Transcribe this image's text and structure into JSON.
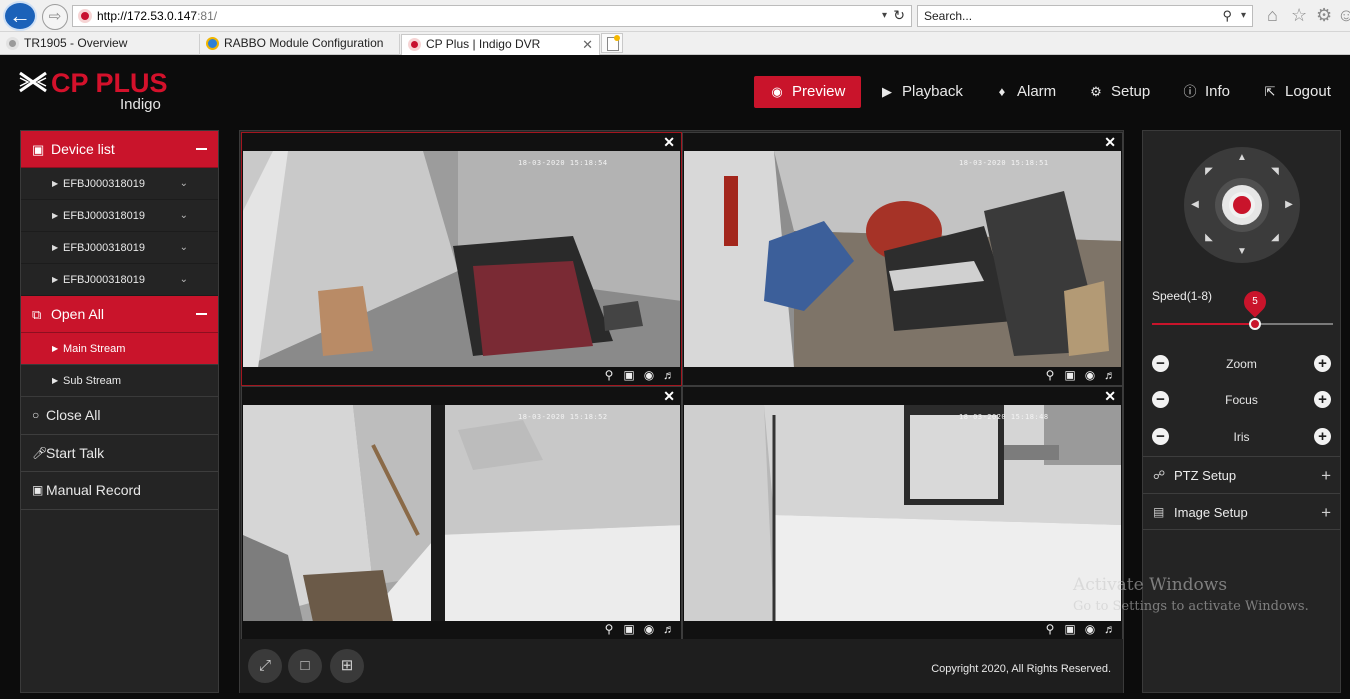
{
  "browser": {
    "url_host": "http://172.53.0.147",
    "url_port": ":81/",
    "search_placeholder": "Search...",
    "tabs": [
      {
        "label": "TR1905 - Overview",
        "active": false
      },
      {
        "label": "RABBO Module Configuration",
        "active": false
      },
      {
        "label": "CP Plus | Indigo DVR",
        "active": true
      }
    ]
  },
  "app": {
    "brand": "CP PLUS",
    "brand_sub": "Indigo",
    "brand_color": "#d4112b",
    "accent": "#c9142b",
    "nav": [
      {
        "label": "Preview",
        "icon": "eye-icon",
        "active": true
      },
      {
        "label": "Playback",
        "icon": "play-icon",
        "active": false
      },
      {
        "label": "Alarm",
        "icon": "bell-icon",
        "active": false
      },
      {
        "label": "Setup",
        "icon": "gear-icon",
        "active": false
      },
      {
        "label": "Info",
        "icon": "info-icon",
        "active": false
      },
      {
        "label": "Logout",
        "icon": "logout-icon",
        "active": false
      }
    ]
  },
  "left_panel": {
    "device_list_label": "Device list",
    "devices": [
      "EFBJ000318019",
      "EFBJ000318019",
      "EFBJ000318019",
      "EFBJ000318019"
    ],
    "open_all_label": "Open All",
    "streams": [
      {
        "label": "Main Stream",
        "selected": true
      },
      {
        "label": "Sub Stream",
        "selected": false
      }
    ],
    "actions": [
      {
        "label": "Close All",
        "icon": "circle-icon"
      },
      {
        "label": "Start Talk",
        "icon": "microphone-icon"
      },
      {
        "label": "Manual Record",
        "icon": "video-camera-icon"
      }
    ]
  },
  "video_wall": {
    "cells": [
      {
        "timestamp": "18-03-2020 15:18:54",
        "selected": true
      },
      {
        "timestamp": "18-03-2020 15:18:51",
        "selected": false
      },
      {
        "timestamp": "18-03-2020 15:18:52",
        "selected": false
      },
      {
        "timestamp": "18-03-2020 15:18:48",
        "selected": false
      }
    ],
    "copyright": "Copyright 2020, All Rights Reserved."
  },
  "ptz": {
    "speed_label": "Speed(1-8)",
    "speed_value": "5",
    "speed_min": 1,
    "speed_max": 8,
    "controls": [
      {
        "label": "Zoom"
      },
      {
        "label": "Focus"
      },
      {
        "label": "Iris"
      }
    ],
    "sections": [
      {
        "label": "PTZ Setup",
        "icon": "ptz-icon"
      },
      {
        "label": "Image Setup",
        "icon": "image-icon"
      }
    ]
  },
  "watermark": {
    "line1": "Activate Windows",
    "line2": "Go to Settings to activate Windows."
  }
}
